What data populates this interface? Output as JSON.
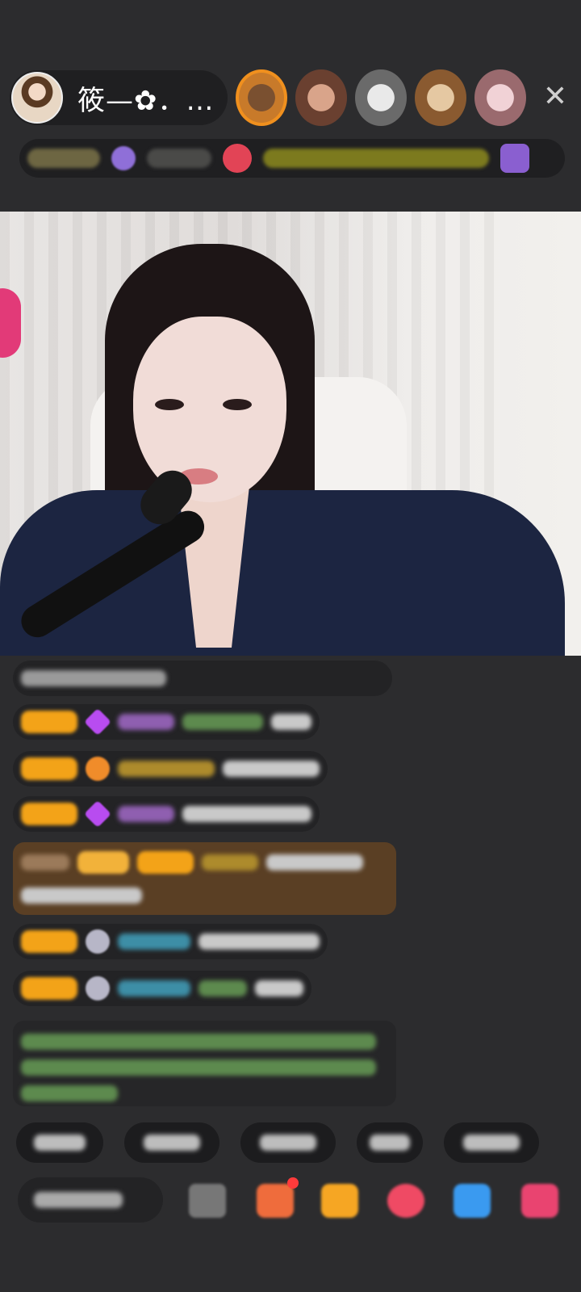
{
  "header": {
    "host_name": "筱—✿．…",
    "close_glyph": "✕",
    "top_viewer_count": 5
  },
  "stream": {
    "has_video": true
  },
  "chat": {
    "message_count": 8
  },
  "quick_replies_count": 5,
  "bottom_bar": {
    "input_placeholder": "",
    "icons": [
      "emoji-icon",
      "gift-icon",
      "treasure-icon",
      "like-heart-icon",
      "game-icon",
      "more-icon"
    ]
  },
  "colors": {
    "background": "#2c2c2e",
    "accent_orange": "#f3a318",
    "special_message_bg": "#5a3f24"
  }
}
